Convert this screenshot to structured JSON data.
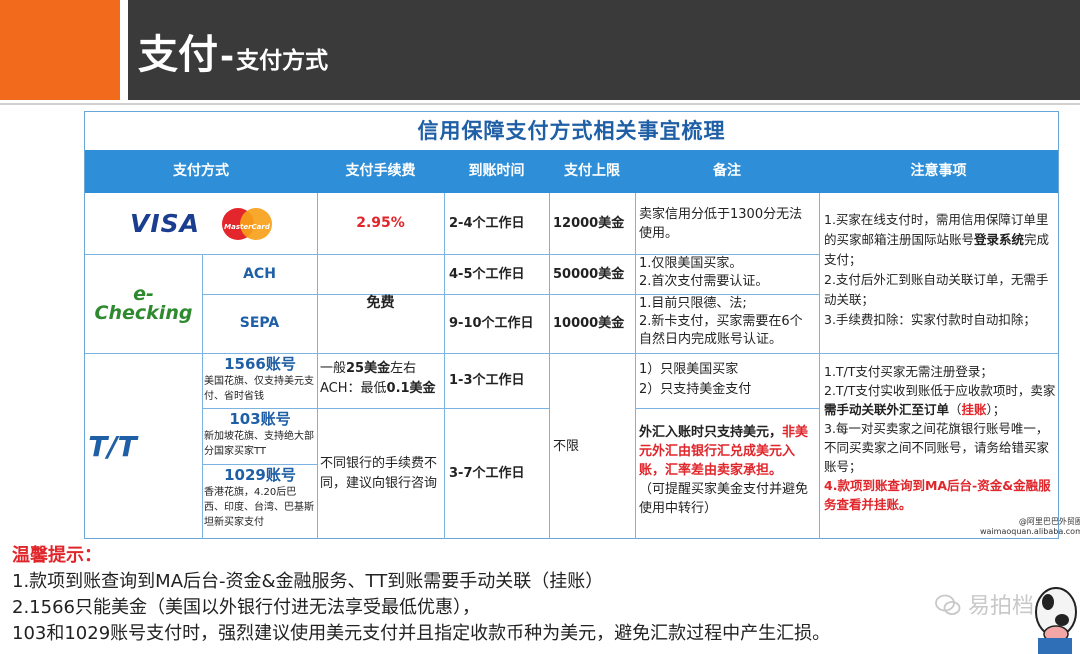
{
  "header": {
    "title_main": "支付",
    "title_dash": "-",
    "title_sub": "支付方式"
  },
  "colors": {
    "orange": "#f26b1d",
    "dark": "#3a3a3a",
    "table_header_blue": "#2e8fd8",
    "title_blue": "#1f5fa6",
    "highlight_red": "#e0262b"
  },
  "table": {
    "title": "信用保障支付方式相关事宜梳理",
    "columns": [
      "支付方式",
      "支付手续费",
      "到账时间",
      "支付上限",
      "备注",
      "注意事项"
    ],
    "card": {
      "visa_logo": "VISA",
      "mastercard_logo": "MasterCard",
      "fee": "2.95%",
      "time": "2-4个工作日",
      "limit": "12000美金",
      "remark": "卖家信用分低于1300分无法使用。"
    },
    "echeck": {
      "logo": "e-Checking",
      "fee": "免费",
      "ach": {
        "name": "ACH",
        "time": "4-5个工作日",
        "limit": "50000美金",
        "remark_1": "1.仅限美国买家。",
        "remark_2": "2.首次支付需要认证。"
      },
      "sepa": {
        "name": "SEPA",
        "time": "9-10个工作日",
        "limit": "10000美金",
        "remark_1": "1.目前只限德、法;",
        "remark_2": "2.新卡支付，买家需要在6个自然日内完成账号认证。"
      }
    },
    "notes_top": {
      "n1_a": "1.买家在线支付时，需用信用保障订单里的买家邮箱注册国际站账号",
      "n1_b": "登录系统",
      "n1_c": "完成支付；",
      "n2": "2.支付后外汇到账自动关联订单，无需手动关联；",
      "n3": "3.手续费扣除：实家付款时自动扣除；"
    },
    "tt": {
      "logo": "T/T",
      "acc_1566": "1566账号",
      "acc_1566_note": "美国花旗、仅支持美元支付、省时省钱",
      "acc_103": "103账号",
      "acc_103_note": "新加坡花旗、支持绝大部分国家买家TT",
      "acc_1029": "1029账号",
      "acc_1029_note": "香港花旗，4.20后巴西、印度、台湾、巴基斯坦新买家支付",
      "fee_1566_a": "一般",
      "fee_1566_b": "25美金",
      "fee_1566_c": "左右",
      "fee_1566_d": "ACH：最低",
      "fee_1566_e": "0.1美金",
      "fee_other": "不同银行的手续费不同，建议向银行咨询",
      "time_1566": "1-3个工作日",
      "time_other": "3-7个工作日",
      "limit": "不限",
      "remark_1566_1": "1）只限美国买家",
      "remark_1566_2": "2）只支持美金支付",
      "remark_other_a": "外汇入账时只支持美元，",
      "remark_other_b": "非美元外汇由银行汇兑成美元入账，汇率差由卖家承担。",
      "remark_other_c": "（可提醒买家美金支付并避免使用中转行）",
      "note_1": "1.T/T支付买家无需注册登录；",
      "note_2_a": "2.T/T支付实收到账低于应收款项时，卖家",
      "note_2_b": "需手动关联外汇至订单",
      "note_2_c": "（",
      "note_2_d": "挂账",
      "note_2_e": "）；",
      "note_3": "3.每一对买卖家之间花旗银行账号唯一，不同买卖家之间不同账号，请务给错买家账号；",
      "note_4": "4.款项到账查询到MA后台-资金&金融服务查看并挂账。",
      "watermark_1": "@阿里巴巴外贸圈",
      "watermark_2": "waimaoquan.alibaba.com"
    }
  },
  "tips": {
    "title": "温馨提示：",
    "line_1": "1.款项到账查询到MA后台-资金&金融服务、TT到账需要手动关联（挂账）",
    "line_2": "2.1566只能美金（美国以外银行付进无法享受最低优惠），",
    "line_3": "103和1029账号支付时，强烈建议使用美元支付并且指定收款币种为美元，避免汇款过程中产生汇损。"
  },
  "brand": {
    "wechat_name": "易拍档",
    "wechat_icon": "wechat-icon"
  }
}
